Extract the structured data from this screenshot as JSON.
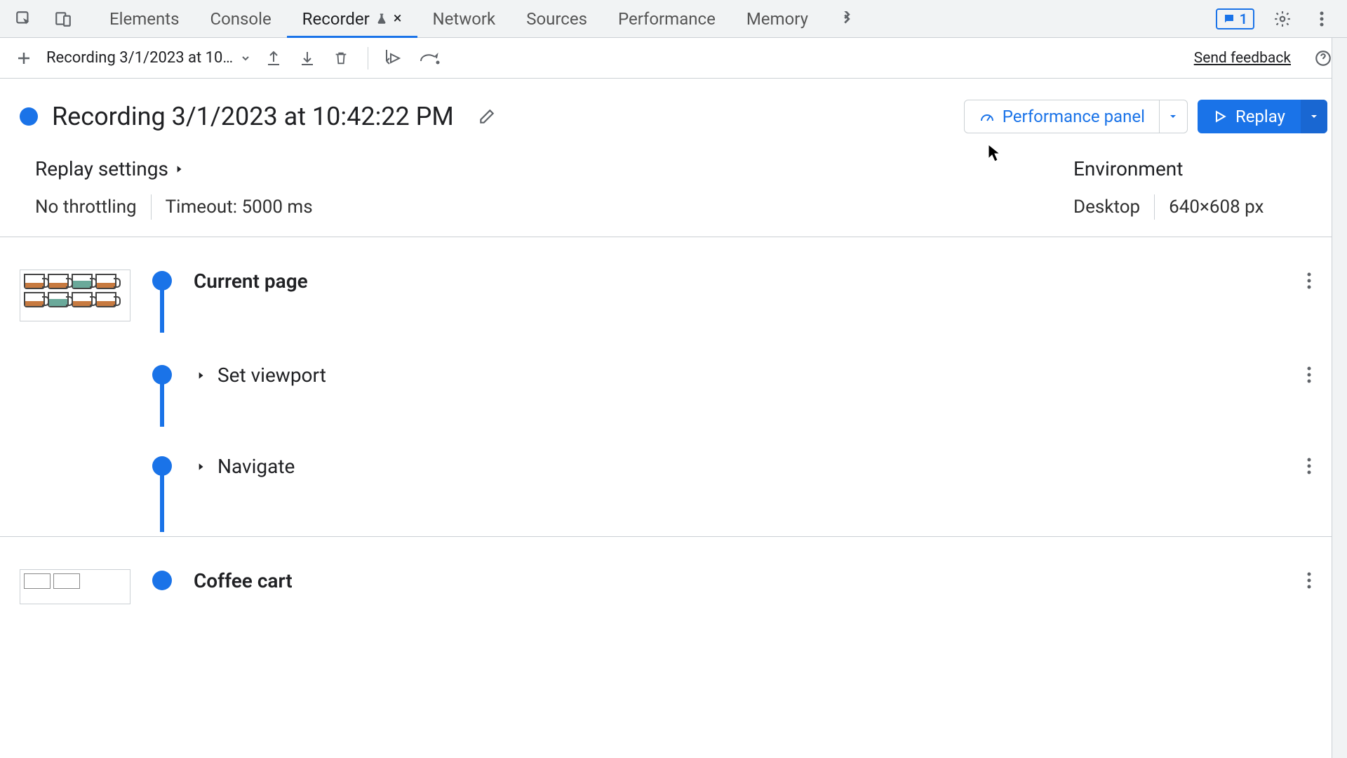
{
  "tabs": {
    "items": [
      "Elements",
      "Console",
      "Recorder",
      "Network",
      "Sources",
      "Performance",
      "Memory"
    ],
    "active_index": 2,
    "recorder_close": "×"
  },
  "issues_count": "1",
  "toolbar": {
    "recording_selector": "Recording 3/1/2023 at 10…",
    "feedback_link": "Send feedback"
  },
  "recording": {
    "title": "Recording 3/1/2023 at 10:42:22 PM",
    "perf_button": "Performance panel",
    "replay_button": "Replay"
  },
  "settings": {
    "replay_heading": "Replay settings",
    "throttling": "No throttling",
    "timeout": "Timeout: 5000 ms",
    "env_heading": "Environment",
    "env_device": "Desktop",
    "env_size": "640×608 px"
  },
  "steps": {
    "group1": {
      "title": "Current page",
      "s1": "Set viewport",
      "s2": "Navigate"
    },
    "group2": {
      "title": "Coffee cart"
    }
  }
}
